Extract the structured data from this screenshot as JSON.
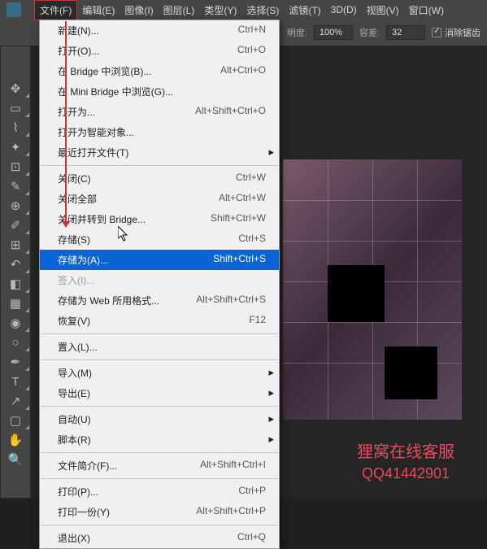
{
  "menubar": {
    "items": [
      {
        "label": "文件(F)"
      },
      {
        "label": "编辑(E)"
      },
      {
        "label": "图像(I)"
      },
      {
        "label": "图层(L)"
      },
      {
        "label": "类型(Y)"
      },
      {
        "label": "选择(S)"
      },
      {
        "label": "滤镜(T)"
      },
      {
        "label": "3D(D)"
      },
      {
        "label": "视图(V)"
      },
      {
        "label": "窗口(W)"
      }
    ]
  },
  "options": {
    "opacity_label": "明度:",
    "opacity_value": "100%",
    "tolerance_label": "容差:",
    "tolerance_value": "32",
    "antialias_label": "消除锯齿"
  },
  "file_menu": {
    "items": [
      {
        "label": "新建(N)...",
        "shortcut": "Ctrl+N"
      },
      {
        "label": "打开(O)...",
        "shortcut": "Ctrl+O"
      },
      {
        "label": "在 Bridge 中浏览(B)...",
        "shortcut": "Alt+Ctrl+O"
      },
      {
        "label": "在 Mini Bridge 中浏览(G)..."
      },
      {
        "label": "打开为...",
        "shortcut": "Alt+Shift+Ctrl+O"
      },
      {
        "label": "打开为智能对象..."
      },
      {
        "label": "最近打开文件(T)",
        "submenu": true
      },
      {
        "sep": true
      },
      {
        "label": "关闭(C)",
        "shortcut": "Ctrl+W"
      },
      {
        "label": "关闭全部",
        "shortcut": "Alt+Ctrl+W"
      },
      {
        "label": "关闭并转到 Bridge...",
        "shortcut": "Shift+Ctrl+W"
      },
      {
        "label": "存储(S)",
        "shortcut": "Ctrl+S"
      },
      {
        "label": "存储为(A)...",
        "shortcut": "Shift+Ctrl+S",
        "selected": true
      },
      {
        "label": "签入(I)...",
        "disabled": true
      },
      {
        "label": "存储为 Web 所用格式...",
        "shortcut": "Alt+Shift+Ctrl+S"
      },
      {
        "label": "恢复(V)",
        "shortcut": "F12"
      },
      {
        "sep": true
      },
      {
        "label": "置入(L)..."
      },
      {
        "sep": true
      },
      {
        "label": "导入(M)",
        "submenu": true
      },
      {
        "label": "导出(E)",
        "submenu": true
      },
      {
        "sep": true
      },
      {
        "label": "自动(U)",
        "submenu": true
      },
      {
        "label": "脚本(R)",
        "submenu": true
      },
      {
        "sep": true
      },
      {
        "label": "文件简介(F)...",
        "shortcut": "Alt+Shift+Ctrl+I"
      },
      {
        "sep": true
      },
      {
        "label": "打印(P)...",
        "shortcut": "Ctrl+P"
      },
      {
        "label": "打印一份(Y)",
        "shortcut": "Alt+Shift+Ctrl+P"
      },
      {
        "sep": true
      },
      {
        "label": "退出(X)",
        "shortcut": "Ctrl+Q"
      }
    ]
  },
  "watermark": {
    "line1": "狸窝在线客服",
    "line2": "QQ41442901"
  }
}
